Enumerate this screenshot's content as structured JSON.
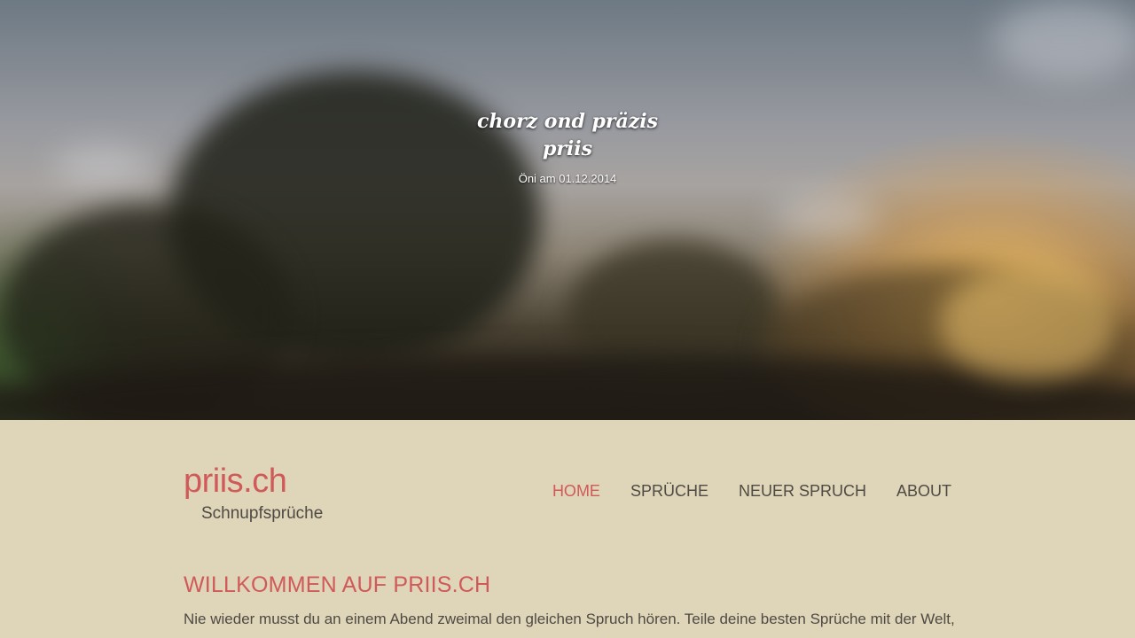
{
  "hero": {
    "title": "chorz ond präzis priis",
    "meta": "Öni am 01.12.2014"
  },
  "site": {
    "name": "priis.ch",
    "tagline": "Schnupfsprüche"
  },
  "nav": {
    "items": [
      {
        "label": "HOME",
        "active": true
      },
      {
        "label": "SPRÜCHE",
        "active": false
      },
      {
        "label": "NEUER SPRUCH",
        "active": false
      },
      {
        "label": "ABOUT",
        "active": false
      }
    ]
  },
  "main": {
    "heading": "WILLKOMMEN AUF PRIIS.CH",
    "intro": "Nie wieder musst du an einem Abend zweimal den gleichen Spruch hören. Teile deine besten Sprüche mit der Welt,"
  },
  "colors": {
    "accent": "#d05a5a",
    "background": "#dfd5b8",
    "text": "#4f4a44"
  }
}
